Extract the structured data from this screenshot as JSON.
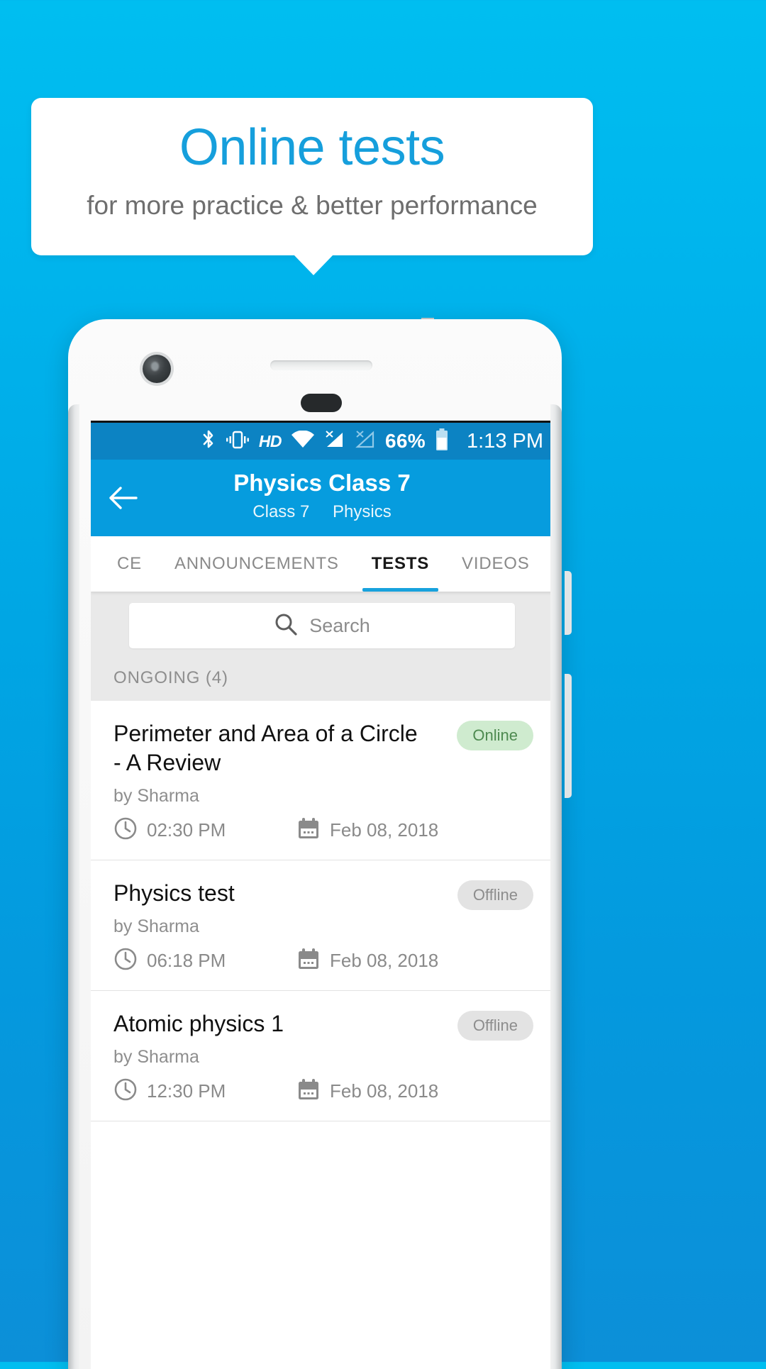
{
  "promo": {
    "title": "Online tests",
    "subtitle": "for more practice & better performance",
    "title_color": "#169FDC",
    "subtitle_color": "#6E6E6E",
    "background_color": "#00B5ED"
  },
  "statusbar": {
    "icons": [
      "bluetooth-icon",
      "vibrate-icon",
      "hd-icon",
      "wifi-icon",
      "signal-off-1-icon",
      "signal-off-2-icon"
    ],
    "hd_label": "HD",
    "battery_percent": "66%",
    "time": "1:13 PM",
    "background_color": "#0C83C3"
  },
  "appbar": {
    "back_icon": "back-arrow-icon",
    "title": "Physics Class 7",
    "subtitle_class": "Class 7",
    "subtitle_subject": "Physics",
    "background_color": "#069CDE"
  },
  "tabs": {
    "items": [
      {
        "label": "CE",
        "active": false
      },
      {
        "label": "ANNOUNCEMENTS",
        "active": false
      },
      {
        "label": "TESTS",
        "active": true
      },
      {
        "label": "VIDEOS",
        "active": false
      }
    ],
    "indicator_color": "#17A2DD"
  },
  "search": {
    "icon": "search-icon",
    "value": "",
    "placeholder": "Search"
  },
  "section": {
    "label": "ONGOING (4)"
  },
  "tests": [
    {
      "title": "Perimeter and Area of a Circle - A Review",
      "author": "by Sharma",
      "time": "02:30 PM",
      "date": "Feb 08, 2018",
      "status": "Online",
      "status_kind": "online"
    },
    {
      "title": "Physics test",
      "author": "by Sharma",
      "time": "06:18 PM",
      "date": "Feb 08, 2018",
      "status": "Offline",
      "status_kind": "offline"
    },
    {
      "title": "Atomic physics 1",
      "author": "by Sharma",
      "time": "12:30 PM",
      "date": "Feb 08, 2018",
      "status": "Offline",
      "status_kind": "offline"
    }
  ]
}
